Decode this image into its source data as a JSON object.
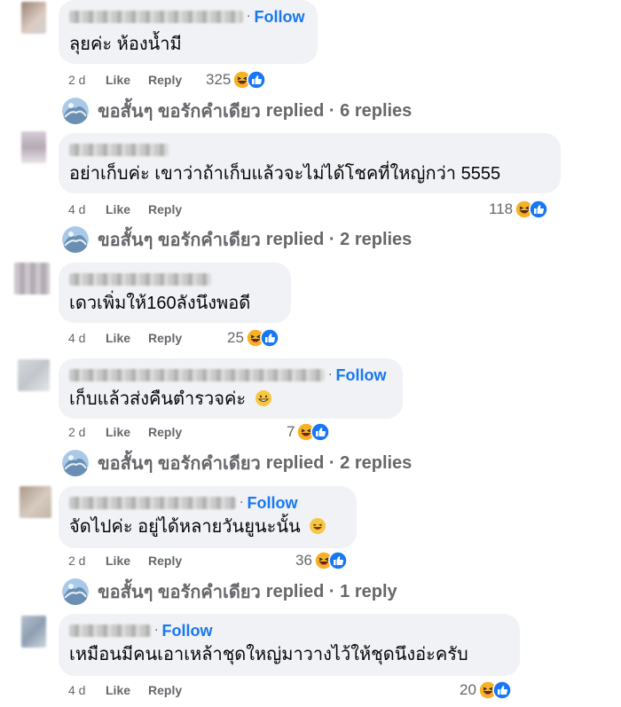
{
  "comments": [
    {
      "follow": "Follow",
      "text": "ลุยค่ะ ห้องน้ำมี",
      "time": "2 d",
      "like": "Like",
      "reply": "Reply",
      "reaction_count": "325",
      "reactions": [
        "haha-icon",
        "like-icon"
      ],
      "replied": {
        "name": "ขอสั้นๆ ขอรักคำเดียว",
        "verb": "replied",
        "sep": " · ",
        "count": "6 replies"
      }
    },
    {
      "follow": "",
      "text": "อย่าเก็บค่ะ เขาว่าถ้าเก็บแล้วจะไม่ได้โชคที่ใหญ่กว่า 5555",
      "time": "4 d",
      "like": "Like",
      "reply": "Reply",
      "reaction_count": "118",
      "reactions": [
        "haha-icon",
        "like-icon"
      ],
      "replied": {
        "name": "ขอสั้นๆ ขอรักคำเดียว",
        "verb": "replied",
        "sep": " · ",
        "count": "2 replies"
      }
    },
    {
      "follow": "",
      "text": "เดวเพิ่มให้160ลังนึงพอดี",
      "time": "4 d",
      "like": "Like",
      "reply": "Reply",
      "reaction_count": "25",
      "reactions": [
        "haha-icon",
        "like-icon"
      ]
    },
    {
      "follow": "Follow",
      "text": "เก็บแล้วส่งคืนตำรวจค่ะ",
      "text_emoji": "grin-icon",
      "time": "2 d",
      "like": "Like",
      "reply": "Reply",
      "reaction_count": "7",
      "reactions": [
        "haha-icon",
        "like-icon"
      ],
      "replied": {
        "name": "ขอสั้นๆ ขอรักคำเดียว",
        "verb": "replied",
        "sep": " · ",
        "count": "2 replies"
      }
    },
    {
      "follow": "Follow",
      "text": "จัดไปค่ะ อยู่ได้หลายวันยูนะนั้น",
      "text_emoji": "laughing-icon",
      "time": "2 d",
      "like": "Like",
      "reply": "Reply",
      "reaction_count": "36",
      "reactions": [
        "haha-icon",
        "like-icon"
      ],
      "replied": {
        "name": "ขอสั้นๆ ขอรักคำเดียว",
        "verb": "replied",
        "sep": " · ",
        "count": "1 reply"
      }
    },
    {
      "follow": "Follow",
      "text": "เหมือนมีคนเอาเหล้าชุดใหญ่มาวางไว้ให้ชุดนึงอ่ะครับ",
      "time": "4 d",
      "like": "Like",
      "reply": "Reply",
      "reaction_count": "20",
      "reactions": [
        "haha-icon",
        "like-icon"
      ]
    }
  ],
  "colors": {
    "link": "#1877f2",
    "bubble": "#f0f2f5",
    "meta": "#65676b",
    "haha": "#f7b125",
    "like": "#1877f2"
  }
}
